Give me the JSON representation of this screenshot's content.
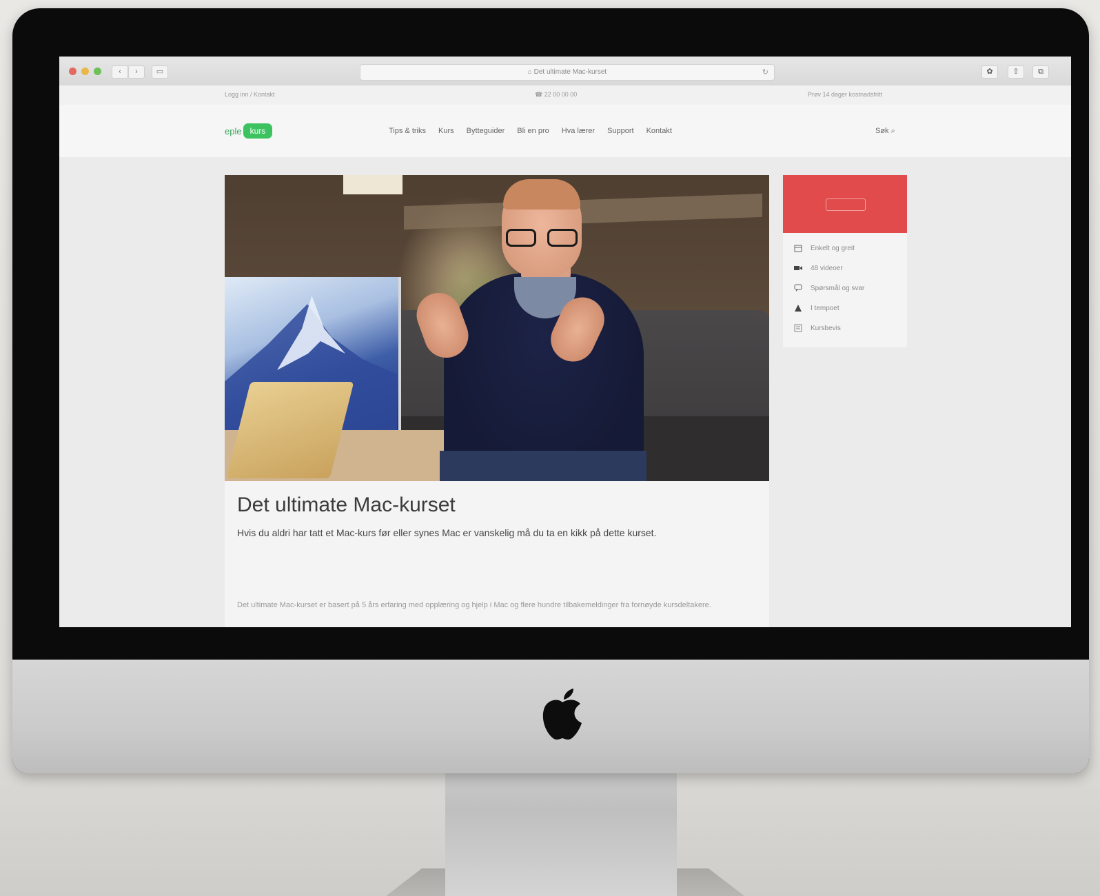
{
  "browser": {
    "address": "⌂  Det ultimate Mac-kurset"
  },
  "site": {
    "topbar": {
      "left": "Logg inn / Kontakt",
      "center": "☎ 22 00 00 00",
      "right": "Prøv 14 dager kostnadsfritt"
    },
    "logo": {
      "prefix": "eple",
      "badge": "kurs"
    },
    "nav": [
      "Tips & triks",
      "Kurs",
      "Bytteguider",
      "Bli en pro",
      "Hva lærer",
      "Support",
      "Kontakt"
    ],
    "search_label": "Søk"
  },
  "article": {
    "title": "Det ultimate Mac-kurset",
    "lead": "Hvis du aldri har tatt et Mac-kurs før eller synes Mac er vanskelig må du ta en kikk på dette kurset.",
    "body": "Det ultimate Mac-kurset er basert på 5 års erfaring med opplæring og hjelp i Mac og flere hundre tilbakemeldinger fra fornøyde kursdeltakere."
  },
  "sidebar": {
    "features": [
      {
        "icon": "calendar-icon",
        "label": "Enkelt og greit"
      },
      {
        "icon": "video-icon",
        "label": "48 videoer"
      },
      {
        "icon": "chat-icon",
        "label": "Spørsmål og svar"
      },
      {
        "icon": "level-icon",
        "label": "I tempoet"
      },
      {
        "icon": "certificate-icon",
        "label": "Kursbevis"
      }
    ]
  },
  "colors": {
    "brand_green": "#3cc35f",
    "cta_red": "#e14b4b"
  }
}
